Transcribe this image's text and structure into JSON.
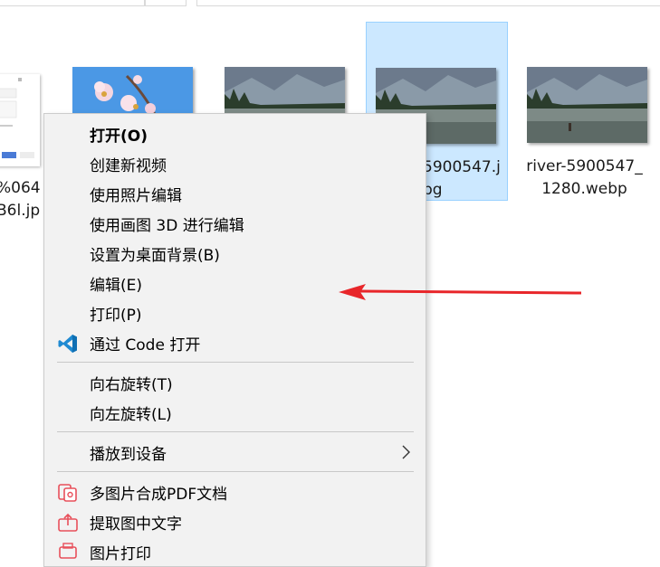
{
  "files": [
    {
      "name_lines": "%064\nB6l.jp",
      "selected": false
    },
    {
      "name_lines": "",
      "selected": false
    },
    {
      "name_lines": "",
      "selected": false
    },
    {
      "name_lines": "5900547.j\npg",
      "selected": true
    },
    {
      "name_lines": "river-5900547_\n1280.webp",
      "selected": false
    }
  ],
  "context_menu": {
    "items": [
      {
        "label": "打开(O)",
        "bold": true
      },
      {
        "label": "创建新视频"
      },
      {
        "label": "使用照片编辑"
      },
      {
        "label": "使用画图 3D 进行编辑"
      },
      {
        "label": "设置为桌面背景(B)"
      },
      {
        "label": "编辑(E)"
      },
      {
        "label": "打印(P)"
      },
      {
        "label": "通过 Code 打开",
        "icon": "vscode-icon"
      },
      {
        "label": "向右旋转(T)"
      },
      {
        "label": "向左旋转(L)"
      },
      {
        "label": "播放到设备",
        "submenu": true
      },
      {
        "label": "多图片合成PDF文档",
        "icon": "pdf-merge-icon"
      },
      {
        "label": "提取图中文字",
        "icon": "text-extract-icon"
      },
      {
        "label": "图片打印",
        "icon": "image-print-icon"
      }
    ]
  },
  "colors": {
    "menu_bg": "#f2f2f2",
    "selection_bg": "#cce8ff",
    "arrow": "#e8262a",
    "vscode_blue": "#1f8ad2",
    "tool_icon_red": "#e8505b"
  }
}
